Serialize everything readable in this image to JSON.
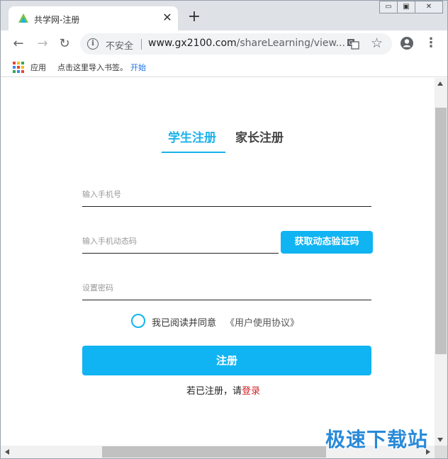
{
  "tab": {
    "title": "共学网-注册",
    "close": "✕",
    "new_tab": "+"
  },
  "window_controls": {
    "minimize": "▭",
    "maximize": "▣",
    "close": "✕"
  },
  "toolbar": {
    "back": "←",
    "forward": "→",
    "reload": "↻",
    "secure_text": "不安全",
    "url_host": "www.gx2100.com",
    "url_path": "/shareLearning/view...",
    "star": "☆",
    "menu": "⋮"
  },
  "bookmarks": {
    "apps": "应用",
    "hint": "点击这里导入书签。",
    "start": "开始"
  },
  "page": {
    "tabs": [
      {
        "label": "学生注册",
        "active": true
      },
      {
        "label": "家长注册",
        "active": false
      }
    ],
    "phone_placeholder": "输入手机号",
    "code_placeholder": "输入手机动态码",
    "password_placeholder": "设置密码",
    "get_code_button": "获取动态验证码",
    "agree_text": "我已阅读并同意",
    "agreement_link": "《用户使用协议》",
    "register_button": "注册",
    "login_prompt": "若已注册，请",
    "login_link": "登录"
  },
  "watermark": "极速下载站",
  "colors": {
    "accent": "#10b4f2",
    "tab_active": "#1ab3ea",
    "login_link": "#d2222a"
  },
  "icons": [
    "favicon-icon",
    "close-icon",
    "plus-icon",
    "back-arrow-icon",
    "forward-arrow-icon",
    "reload-icon",
    "info-icon",
    "translate-icon",
    "star-icon",
    "account-icon",
    "menu-dots-icon",
    "apps-grid-icon",
    "radio-circle-icon"
  ]
}
